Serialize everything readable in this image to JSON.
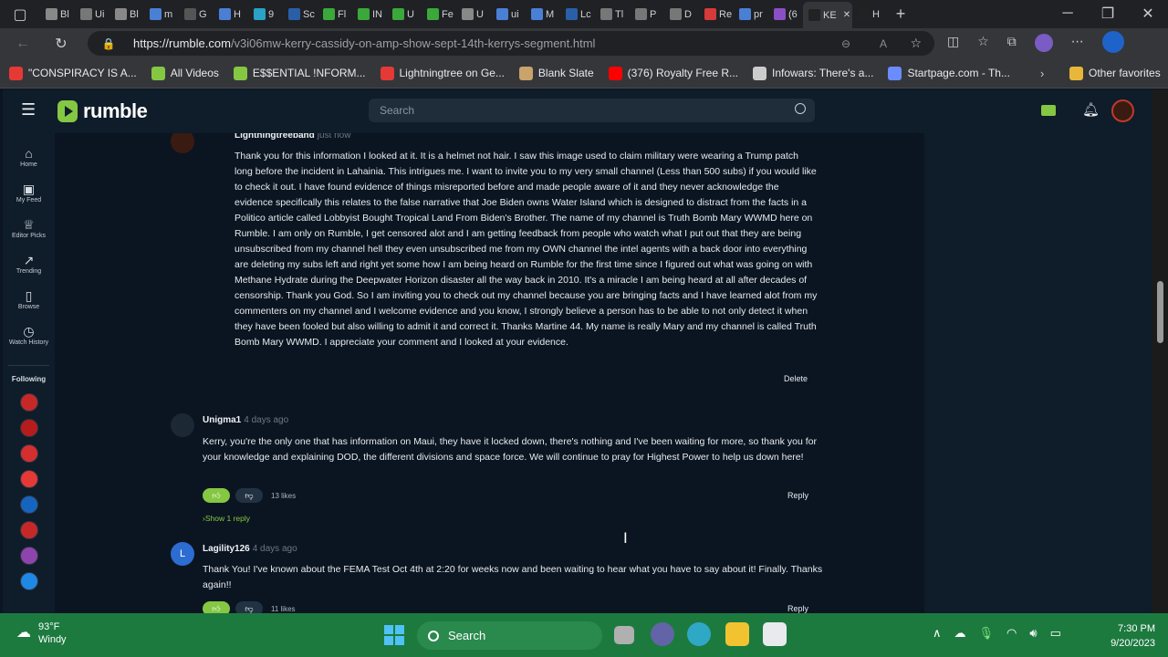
{
  "browser": {
    "tabs": [
      "Bl",
      "Ui",
      "Bl",
      "m",
      "G",
      "H",
      "9",
      "Sc",
      "Fl",
      "IN",
      "U",
      "Fe",
      "U",
      "ui",
      "M",
      "Lc",
      "Tl",
      "P",
      "D",
      "Re",
      "pr",
      "(6",
      "KE",
      "H"
    ],
    "url_domain": "https://rumble.com",
    "url_path": "/v3i06mw-kerry-cassidy-on-amp-show-sept-14th-kerrys-segment.html",
    "bookmarks": [
      {
        "label": "\"CONSPIRACY IS A...",
        "color": "#e53935"
      },
      {
        "label": "All Videos",
        "color": "#85c742"
      },
      {
        "label": "E$$ENTIAL !NFORM...",
        "color": "#85c742"
      },
      {
        "label": "Lightningtree on Ge...",
        "color": "#e53935"
      },
      {
        "label": "Blank Slate",
        "color": "#c9a36a"
      },
      {
        "label": "(376) Royalty Free R...",
        "color": "#ff0000"
      },
      {
        "label": "Infowars: There's a...",
        "color": "#cccccc"
      },
      {
        "label": "Startpage.com - Th...",
        "color": "#6b8cff"
      }
    ],
    "other_favorites": "Other favorites"
  },
  "site": {
    "logo": "rumble",
    "search_placeholder": "Search",
    "brand_color": "#85c742"
  },
  "sidebar": {
    "items": [
      {
        "label": "Home",
        "icon": "home-icon"
      },
      {
        "label": "My Feed",
        "icon": "feed-icon"
      },
      {
        "label": "Editor Picks",
        "icon": "award-icon"
      },
      {
        "label": "Trending",
        "icon": "trending-icon"
      },
      {
        "label": "Browse",
        "icon": "browse-icon"
      },
      {
        "label": "Watch History",
        "icon": "history-icon"
      }
    ],
    "following_label": "Following"
  },
  "comments": [
    {
      "author": "Lightningtreeband",
      "time": "just now",
      "text": "Thank you for this information I looked at it. It is a helmet not hair. I saw this image used to claim military were wearing a Trump patch long before the incident in Lahainia. This intrigues me. I want to invite you to my very small channel (Less than 500 subs) if you would like to check it out. I have found evidence of things misreported before and made people aware of it and they never acknowledge the evidence specifically this relates to the false narrative that Joe Biden owns Water Island which is designed to distract from the facts in a Politico article called Lobbyist Bought Tropical Land From Biden's Brother. The name of my channel is Truth Bomb Mary WWMD here on Rumble. I am only on Rumble, I get censored alot and I am getting feedback from people who watch what I put out that they are being unsubscribed from my channel hell they even unsubscribed me from my OWN channel the intel agents with a back door into everything are deleting my subs left and right yet some how I am being heard on Rumble for the first time since I figured out what was going on with Methane Hydrate during the Deepwater Horizon disaster all the way back in 2010. It's a miracle I am being heard at all after decades of censorship. Thank you God. So I am inviting you to check out my channel because you are bringing facts and I have learned alot from my commenters on my channel and I welcome evidence and you know, I strongly believe a person has to be able to not only detect it when they have been fooled but also willing to admit it and correct it. Thanks Martine 44. My name is really Mary and my channel is called Truth Bomb Mary WWMD. I appreciate your comment and I looked at your evidence.",
      "action": "Delete"
    },
    {
      "author": "Unigma1",
      "time": "4 days ago",
      "text": "Kerry, you're the only one that has information on Maui, they have it locked down, there's nothing and I've been waiting for more, so thank you for your knowledge and explaining DOD, the different divisions and space force. We will continue to pray for Highest Power to help us down here!",
      "likes": "13 likes",
      "action": "Reply",
      "show_replies": "›Show 1 reply"
    },
    {
      "author": "Lagility126",
      "time": "4 days ago",
      "avatar_letter": "L",
      "text": "Thank You! I've known about the FEMA Test Oct 4th at 2:20 for weeks now and been waiting to hear what you have to say about it! Finally. Thanks again!!",
      "likes": "11 likes",
      "action": "Reply"
    }
  ],
  "taskbar": {
    "temp": "93°F",
    "condition": "Windy",
    "search_label": "Search",
    "time": "7:30 PM",
    "date": "9/20/2023"
  }
}
